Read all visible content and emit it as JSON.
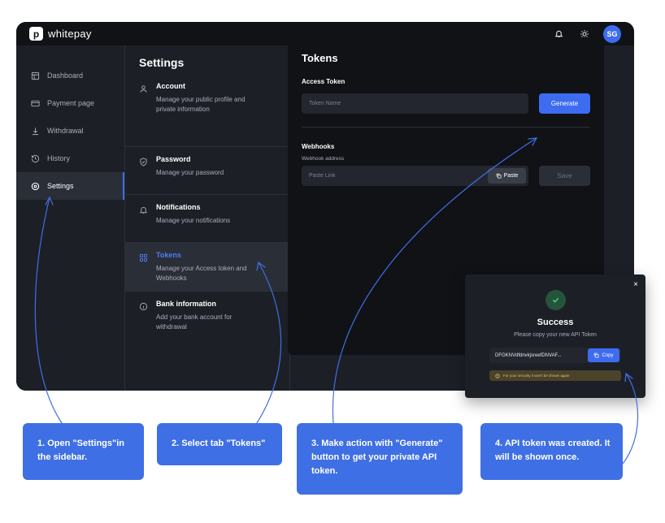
{
  "app": {
    "logo_mark": "p",
    "logo_text": "whitepay",
    "avatar_initials": "SG"
  },
  "sidebar": {
    "items": [
      {
        "label": "Dashboard",
        "icon": "dashboard-icon"
      },
      {
        "label": "Payment page",
        "icon": "card-icon"
      },
      {
        "label": "Withdrawal",
        "icon": "download-icon"
      },
      {
        "label": "History",
        "icon": "history-icon"
      },
      {
        "label": "Settings",
        "icon": "gear-icon",
        "active": true
      }
    ]
  },
  "settings": {
    "title": "Settings",
    "items": [
      {
        "name": "Account",
        "desc": "Manage your public profile and private information",
        "icon": "user-icon"
      },
      {
        "name": "Password",
        "desc": "Manage your password",
        "icon": "shield-icon"
      },
      {
        "name": "Notifications",
        "desc": "Manage your notifications",
        "icon": "bell-icon"
      },
      {
        "name": "Tokens",
        "desc": "Manage your Access token and Webhooks",
        "icon": "grid-icon",
        "active": true
      },
      {
        "name": "Bank information",
        "desc": "Add your bank account for withdrawal",
        "icon": "info-icon"
      }
    ]
  },
  "tokens": {
    "title": "Tokens",
    "access_token_label": "Access Token",
    "token_name_placeholder": "Token Name",
    "generate_label": "Generate",
    "webhooks_label": "Webhooks",
    "webhook_address_label": "Webhook address",
    "paste_link_placeholder": "Paste Link",
    "paste_label": "Paste",
    "save_label": "Save"
  },
  "popup": {
    "close": "×",
    "title": "Success",
    "subtitle": "Please copy your new API Token",
    "token_value": "DFGKNVdfdnvkjsreefDNVAF...",
    "copy_label": "Copy",
    "warning": "For your security it won't be shown again"
  },
  "callouts": [
    "1. Open \"Settings\"in the sidebar.",
    "2. Select tab \"Tokens\"",
    "3. Make action with \"Generate\" button to get your private API token.",
    "4. API token was created. It will be shown once."
  ],
  "colors": {
    "accent": "#3d6cf0",
    "callout": "#3f6fe4",
    "app_bg": "#1c1f26",
    "card_bg": "#101216",
    "success": "#24553a",
    "warning_bg": "#4a432a"
  }
}
